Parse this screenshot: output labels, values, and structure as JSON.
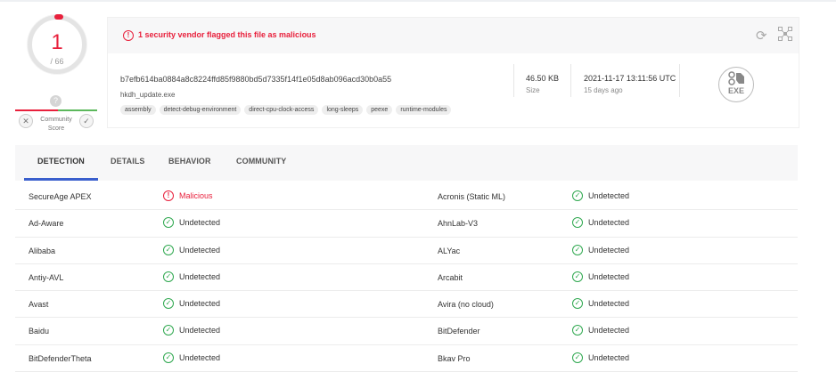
{
  "score": {
    "detections": "1",
    "total": "/ 66",
    "community_question": "?",
    "community_label": "Community Score",
    "vote_down": "✕",
    "vote_up": "✓"
  },
  "alert": {
    "icon": "!",
    "text": "1 security vendor flagged this file as malicious"
  },
  "file": {
    "hash": "b7efb614ba0884a8c8224ffd85f9880bd5d7335f14f1e05d8ab096acd30b0a55",
    "name": "hkdh_update.exe",
    "tags": [
      "assembly",
      "detect-debug-environment",
      "direct-cpu-clock-access",
      "long-sleeps",
      "peexe",
      "runtime-modules"
    ],
    "size_value": "46.50 KB",
    "size_label": "Size",
    "date_value": "2021-11-17 13:11:56 UTC",
    "date_label": "15 days ago",
    "type_badge": "EXE"
  },
  "tabs": [
    "DETECTION",
    "DETAILS",
    "BEHAVIOR",
    "COMMUNITY"
  ],
  "detections": [
    {
      "v1": "SecureAge APEX",
      "s1": "Malicious",
      "v2": "Acronis (Static ML)",
      "s2": "Undetected"
    },
    {
      "v1": "Ad-Aware",
      "s1": "Undetected",
      "v2": "AhnLab-V3",
      "s2": "Undetected"
    },
    {
      "v1": "Alibaba",
      "s1": "Undetected",
      "v2": "ALYac",
      "s2": "Undetected"
    },
    {
      "v1": "Antiy-AVL",
      "s1": "Undetected",
      "v2": "Arcabit",
      "s2": "Undetected"
    },
    {
      "v1": "Avast",
      "s1": "Undetected",
      "v2": "Avira (no cloud)",
      "s2": "Undetected"
    },
    {
      "v1": "Baidu",
      "s1": "Undetected",
      "v2": "BitDefender",
      "s2": "Undetected"
    },
    {
      "v1": "BitDefenderTheta",
      "s1": "Undetected",
      "v2": "Bkav Pro",
      "s2": "Undetected"
    }
  ],
  "colors": {
    "malicious": "#e8203c",
    "clean": "#2fa84f",
    "tab_accent": "#3a5fcd"
  }
}
